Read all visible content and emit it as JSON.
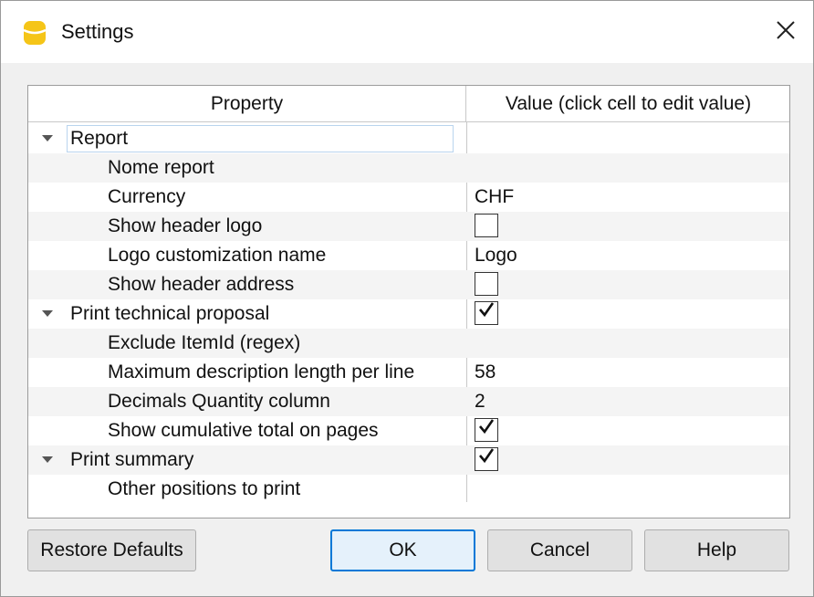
{
  "window": {
    "title": "Settings"
  },
  "header": {
    "property": "Property",
    "value": "Value (click cell to edit value)"
  },
  "rows": [
    {
      "label": "Report",
      "level": 0,
      "expander": true,
      "selected": true,
      "value": "",
      "checkbox": null
    },
    {
      "label": "Nome report",
      "level": 1,
      "value": "",
      "checkbox": null
    },
    {
      "label": "Currency",
      "level": 1,
      "value": "CHF",
      "checkbox": null
    },
    {
      "label": "Show header logo",
      "level": 1,
      "value": "",
      "checkbox": false
    },
    {
      "label": "Logo customization name",
      "level": 1,
      "value": "Logo",
      "checkbox": null
    },
    {
      "label": "Show header address",
      "level": 1,
      "value": "",
      "checkbox": false
    },
    {
      "label": "Print technical proposal",
      "level": 0,
      "expander": true,
      "value": "",
      "checkbox": true
    },
    {
      "label": "Exclude ItemId (regex)",
      "level": 1,
      "value": "",
      "checkbox": null
    },
    {
      "label": "Maximum description length per line",
      "level": 1,
      "value": "58",
      "checkbox": null
    },
    {
      "label": "Decimals Quantity column",
      "level": 1,
      "value": "2",
      "checkbox": null
    },
    {
      "label": "Show cumulative total on pages",
      "level": 1,
      "value": "",
      "checkbox": true
    },
    {
      "label": "Print summary",
      "level": 0,
      "expander": true,
      "value": "",
      "checkbox": true
    },
    {
      "label": "Other positions to print",
      "level": 1,
      "value": "",
      "checkbox": null
    }
  ],
  "buttons": {
    "restore_defaults": "Restore Defaults",
    "ok": "OK",
    "cancel": "Cancel",
    "help": "Help"
  },
  "icons": {
    "app": "database-icon",
    "close": "close-icon",
    "expander": "triangle-down-icon",
    "check": "checkmark-icon"
  },
  "colors": {
    "accent": "#0078d7",
    "selection_border": "#b9d4ee",
    "app_icon": "#f5c518"
  }
}
